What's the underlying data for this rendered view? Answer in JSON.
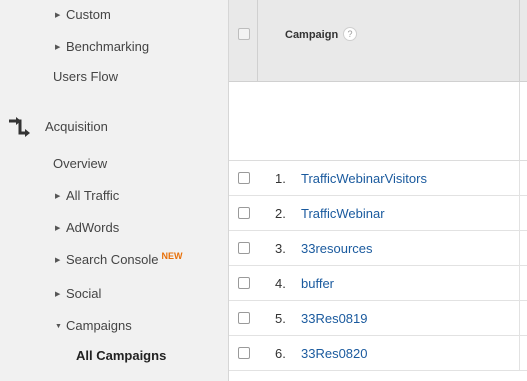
{
  "sidebar": {
    "items": [
      {
        "label": "Custom",
        "caret": "right"
      },
      {
        "label": "Benchmarking",
        "caret": "right"
      },
      {
        "label": "Users Flow"
      },
      {
        "label": "Acquisition",
        "icon": "acquisition-icon"
      },
      {
        "label": "Overview"
      },
      {
        "label": "All Traffic",
        "caret": "right"
      },
      {
        "label": "AdWords",
        "caret": "right"
      },
      {
        "label": "Search Console",
        "caret": "right",
        "badge": "NEW"
      },
      {
        "label": "Social",
        "caret": "right"
      },
      {
        "label": "Campaigns",
        "caret": "down"
      },
      {
        "label": "All Campaigns",
        "active": true
      }
    ]
  },
  "table": {
    "column_header": "Campaign",
    "help_glyph": "?",
    "rows": [
      {
        "num": "1.",
        "name": "TrafficWebinarVisitors"
      },
      {
        "num": "2.",
        "name": "TrafficWebinar"
      },
      {
        "num": "3.",
        "name": "33resources"
      },
      {
        "num": "4.",
        "name": "buffer"
      },
      {
        "num": "5.",
        "name": "33Res0819"
      },
      {
        "num": "6.",
        "name": "33Res0820"
      }
    ]
  },
  "colors": {
    "link": "#1a5a9e",
    "badge": "#e8710a",
    "sidebar_bg": "#f1f1f1",
    "header_bg": "#e9e9e9"
  }
}
